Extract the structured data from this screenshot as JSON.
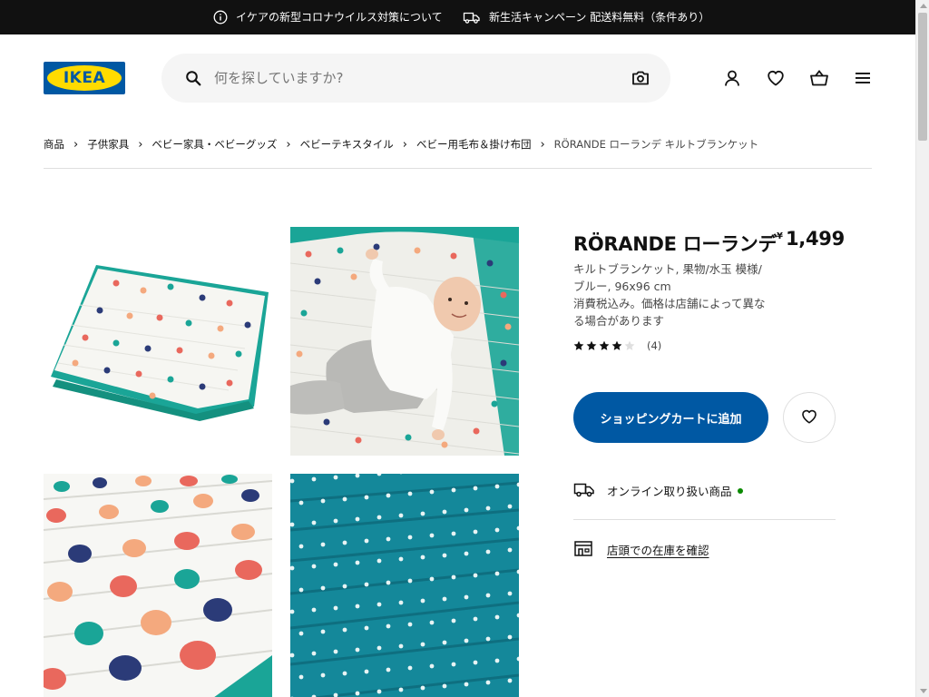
{
  "announcements": [
    {
      "icon": "info-icon",
      "text": "イケアの新型コロナウイルス対策について"
    },
    {
      "icon": "delivery-truck-icon",
      "text": "新生活キャンペーン 配送料無料（条件あり）"
    }
  ],
  "header": {
    "logo_text": "IKEA",
    "search_placeholder": "何を探していますか?",
    "icons": [
      "user-icon",
      "heart-icon",
      "shopping-bag-icon",
      "menu-icon"
    ]
  },
  "breadcrumb": [
    "商品",
    "子供家具",
    "ベビー家具・ベビーグッズ",
    "ベビーテキスタイル",
    "ベビー用毛布＆掛け布団",
    "RÖRANDE ローランデ キルトブランケット"
  ],
  "product": {
    "name": "RÖRANDE ローランデ",
    "currency": "¥",
    "price": "1,499",
    "description_line1": "キルトブランケット, 果物/水玉 模様/",
    "description_line2": "ブルー, 96x96 cm",
    "tax_line1": "消費税込み。価格は店舗によって異な",
    "tax_line2": "る場合があります",
    "rating": 4,
    "rating_max": 5,
    "review_count": "(4)",
    "add_to_cart": "ショッピングカートに追加",
    "online_label": "オンライン取り扱い商品",
    "store_label": "店頭での在庫を確認"
  },
  "colors": {
    "brand_blue": "#0058a3",
    "brand_yellow": "#ffdb00",
    "available_green": "#0a8a00",
    "topbar_bg": "#111111"
  },
  "gallery": [
    {
      "name": "folded-blanket-photo"
    },
    {
      "name": "baby-on-blanket-photo"
    },
    {
      "name": "fruit-pattern-closeup-photo"
    },
    {
      "name": "dot-pattern-reverse-photo"
    }
  ]
}
